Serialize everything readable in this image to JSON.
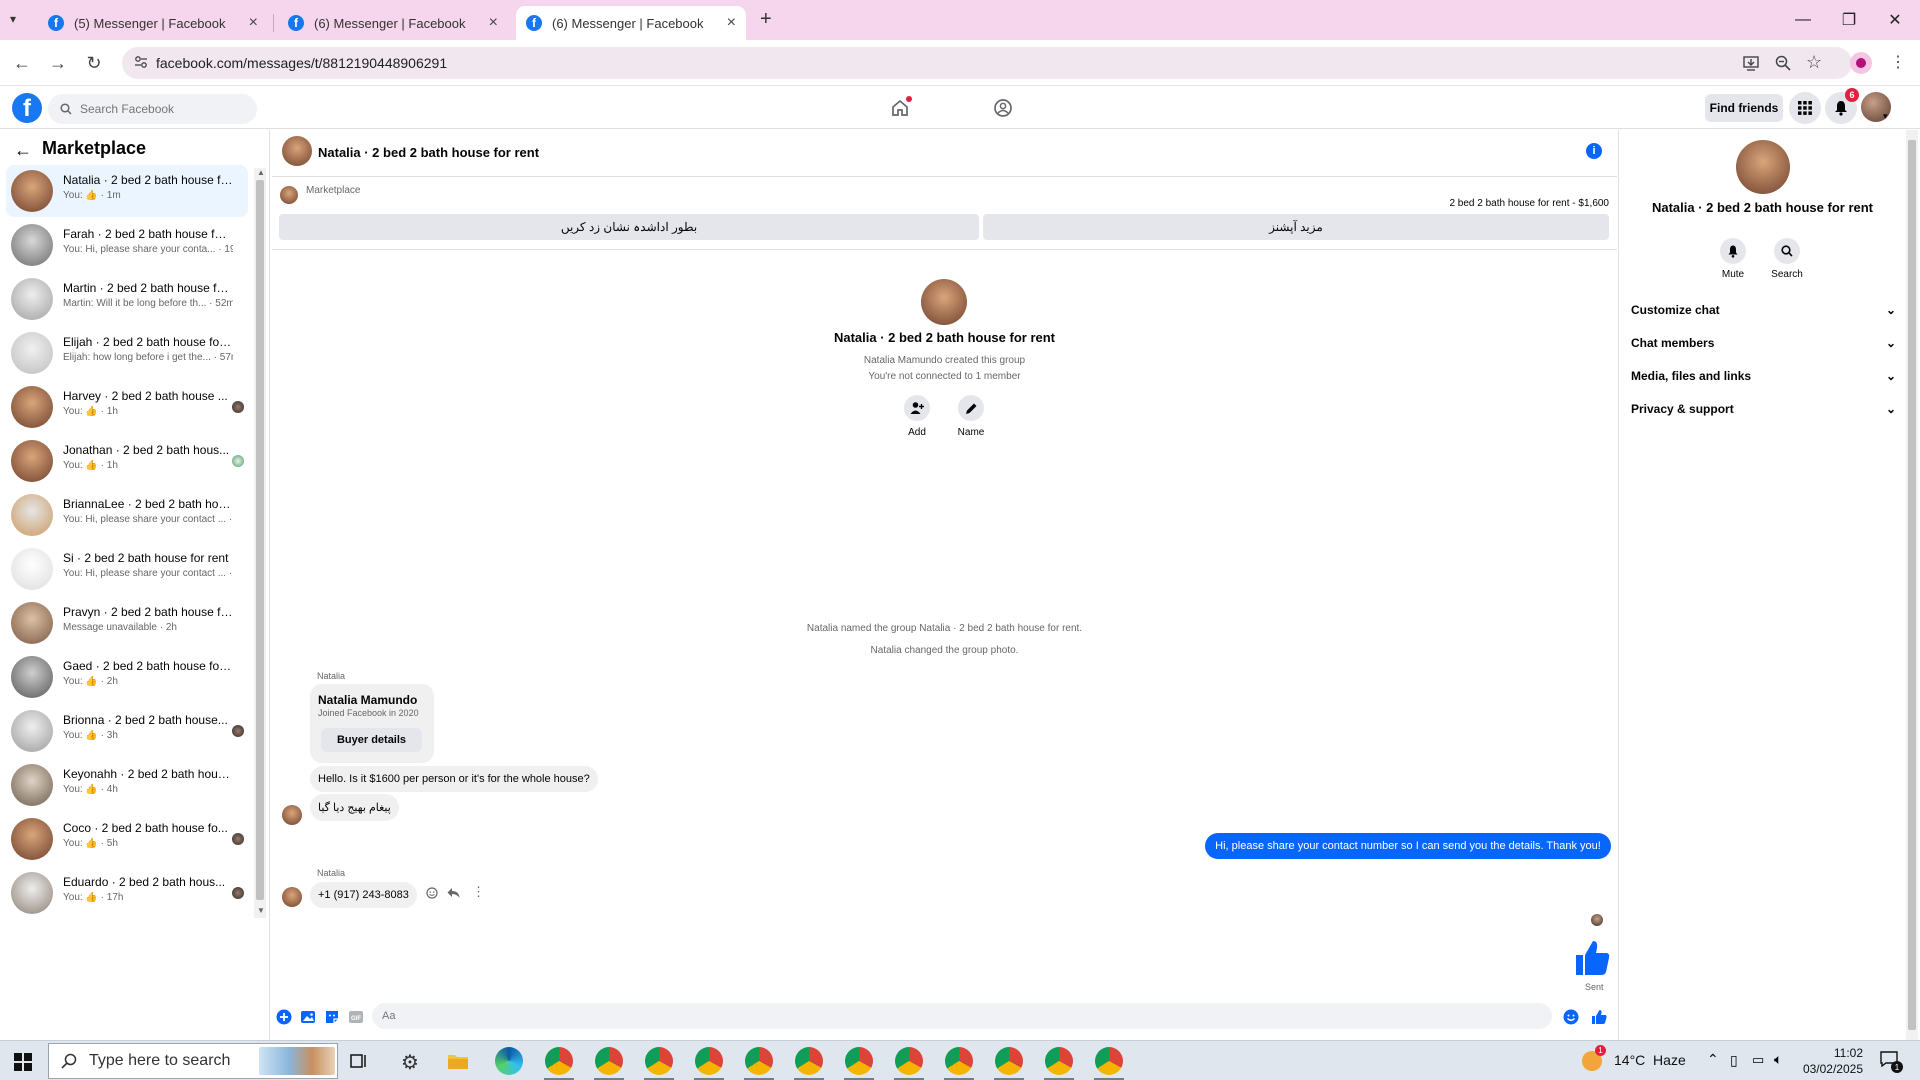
{
  "browser": {
    "tabs": [
      {
        "title": "(5) Messenger | Facebook"
      },
      {
        "title": "(6) Messenger | Facebook"
      },
      {
        "title": "(6) Messenger | Facebook"
      }
    ],
    "url": "facebook.com/messages/t/8812190448906291"
  },
  "fb": {
    "search_placeholder": "Search Facebook",
    "find_friends": "Find friends",
    "notif_count": "6",
    "colors": {
      "brand": "#1877f2",
      "messenger_blue": "#0866ff",
      "active_conv_bg": "#ebf5ff"
    }
  },
  "sidebar": {
    "title": "Marketplace",
    "conversations": [
      {
        "name": "Natalia · 2 bed 2 bath house fo...",
        "snippet": "You: 👍 · 1m",
        "active": true
      },
      {
        "name": "Farah · 2 bed 2 bath house for r...",
        "snippet": "You: Hi, please share your conta... · 19m"
      },
      {
        "name": "Martin · 2 bed 2 bath house for...",
        "snippet": "Martin: Will it be long before th... · 52m"
      },
      {
        "name": "Elijah · 2 bed 2 bath house for r...",
        "snippet": "Elijah: how long before i get the... · 57m"
      },
      {
        "name": "Harvey · 2 bed 2 bath house ...",
        "snippet": "You: 👍 · 1h"
      },
      {
        "name": "Jonathan · 2 bed 2 bath hous...",
        "snippet": "You: 👍 · 1h"
      },
      {
        "name": "BriannaLee · 2 bed 2 bath hous...",
        "snippet": "You: Hi, please share your contact ... · 1h"
      },
      {
        "name": "Si · 2 bed 2 bath house for rent",
        "snippet": "You: Hi, please share your contact ... · 1h"
      },
      {
        "name": "Pravyn · 2 bed 2 bath house for...",
        "snippet": "Message unavailable · 2h"
      },
      {
        "name": "Gaed · 2 bed 2 bath house for r...",
        "snippet": "You: 👍 · 2h"
      },
      {
        "name": "Brionna · 2 bed 2 bath house...",
        "snippet": "You: 👍 · 3h"
      },
      {
        "name": "Keyonahh · 2 bed 2 bath house...",
        "snippet": "You: 👍 · 4h"
      },
      {
        "name": "Coco · 2 bed 2 bath house fo...",
        "snippet": "You: 👍 · 5h"
      },
      {
        "name": "Eduardo · 2 bed 2 bath hous...",
        "snippet": "You: 👍 · 17h"
      }
    ]
  },
  "chat": {
    "title": "Natalia · 2 bed 2 bath house for rent",
    "marketplace_label": "Marketplace",
    "listing_price": "2 bed 2 bath house for rent - $1,600",
    "btn_mark_sold": "بطور اداشدہ نشان زد کریں",
    "btn_more_options": "مزید آپشنز",
    "group_title": "Natalia · 2 bed 2 bath house for rent",
    "created_by": "Natalia Mamundo created this group",
    "not_connected": "You're not connected to 1 member",
    "action_add": "Add",
    "action_name": "Name",
    "sys_named": "Natalia named the group Natalia · 2 bed 2 bath house for rent.",
    "sys_photo": "Natalia changed the group photo.",
    "sender1": "Natalia",
    "card_name": "Natalia Mamundo",
    "card_sub": "Joined Facebook in 2020",
    "buyer_details": "Buyer details",
    "msg1": "Hello. Is it $1600 per person or it's for the whole house?",
    "msg2": "پیغام بھیج دیا گیا",
    "my_msg": "Hi, please share your contact number so I can send you the details. Thank you!",
    "sender2": "Natalia",
    "msg3": "+1 (917) 243-8083",
    "sent_label": "Sent",
    "composer_placeholder": "Aa"
  },
  "info_panel": {
    "title": "Natalia · 2 bed 2 bath house for rent",
    "mute": "Mute",
    "search": "Search",
    "rows": [
      "Customize chat",
      "Chat members",
      "Media, files and links",
      "Privacy & support"
    ]
  },
  "taskbar": {
    "search_placeholder": "Type here to search",
    "weather": "14°C  Haze",
    "time": "11:02",
    "date": "03/02/2025",
    "weather_badge": "1",
    "notif_badge": "1"
  }
}
